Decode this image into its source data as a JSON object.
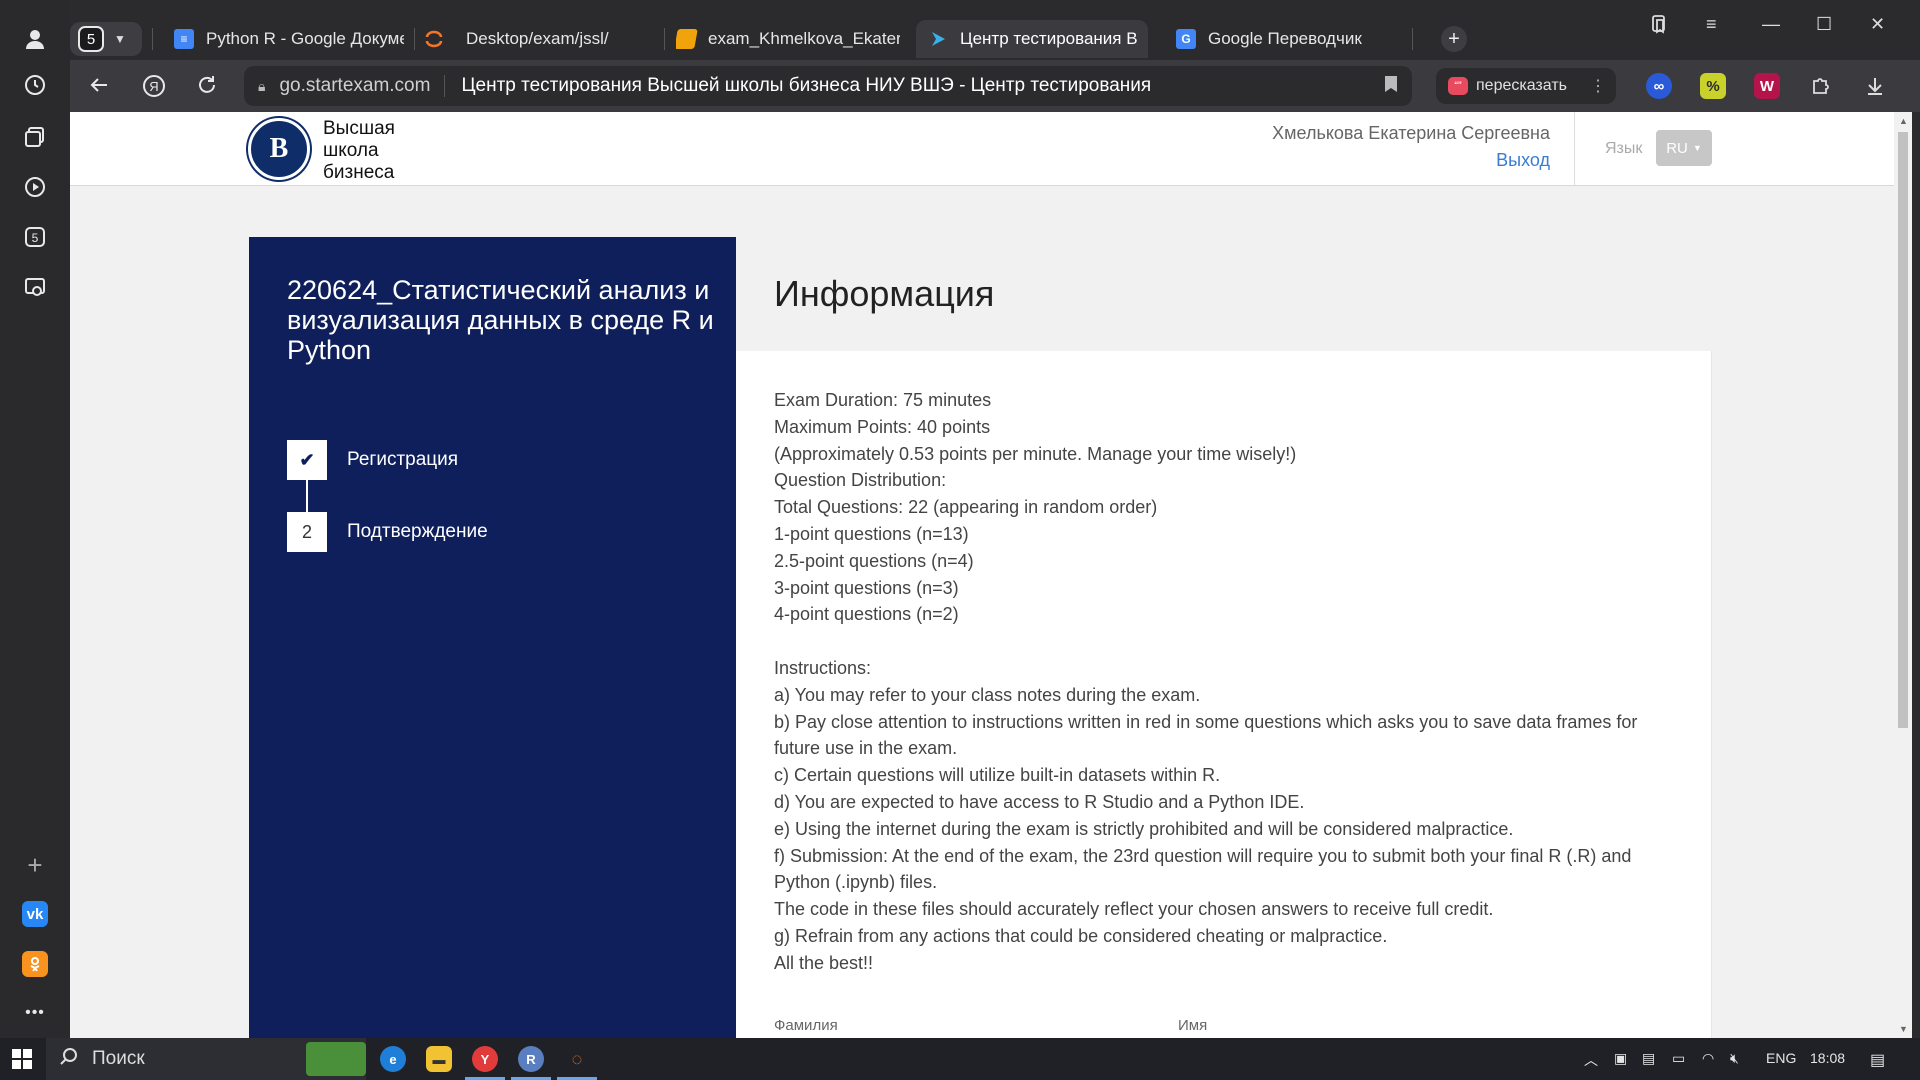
{
  "browser": {
    "tab_count": "5",
    "tabs": [
      {
        "label": "Python R - Google Докуме",
        "icon": "google-docs-icon",
        "color": "#4285f4"
      },
      {
        "label": "Desktop/exam/jssl/",
        "icon": "jupyter-icon",
        "color": "#f37626"
      },
      {
        "label": "exam_Khmelkova_Ekaterin",
        "icon": "notebook-icon",
        "color": "#f0a30a"
      },
      {
        "label": "Центр тестирования В",
        "icon": "startexam-icon",
        "color": "#3ab0e8",
        "active": true
      },
      {
        "label": "Google Переводчик",
        "icon": "google-translate-icon",
        "color": "#4285f4"
      }
    ],
    "address": {
      "domain": "go.startexam.com",
      "title": "Центр тестирования Высшей школы бизнеса НИУ ВШЭ - Центр тестирования"
    },
    "retell_label": "пересказать"
  },
  "header": {
    "logo_letter": "В",
    "logo_line1": "Высшая",
    "logo_line2": "школа",
    "logo_line3": "бизнеса",
    "user_name": "Хмелькова Екатерина Сергеевна",
    "logout": "Выход",
    "lang_label": "Язык",
    "lang_value": "RU"
  },
  "sidebar": {
    "course_title": "220624_Статистический анализ и визуализация данных в среде R и Python",
    "steps": [
      {
        "marker": "✔",
        "label": "Регистрация"
      },
      {
        "marker": "2",
        "label": "Подтверждение"
      }
    ]
  },
  "main": {
    "heading": "Информация",
    "lines": [
      "Exam Duration: 75 minutes",
      "Maximum Points: 40 points",
      "(Approximately 0.53 points per minute. Manage your time wisely!)",
      "Question Distribution:",
      "Total Questions: 22 (appearing in random order)",
      "1-point questions (n=13)",
      "2.5-point questions (n=4)",
      "3-point questions (n=3)",
      "4-point questions (n=2)",
      "",
      "Instructions:",
      "a) You may refer to your class notes during the exam.",
      "b) Pay close attention to instructions written in red in some questions which asks you to save data frames for future use in the exam.",
      "c) Certain questions will utilize built-in datasets within R.",
      "d) You are expected to have access to R Studio and a Python IDE.",
      "e) Using the internet during the exam is strictly prohibited and will be considered malpractice.",
      "f) Submission: At the end of the exam, the 23rd question will require you to submit both your final R (.R) and Python (.ipynb) files.",
      "The code in these files should accurately reflect your chosen answers to receive full credit.",
      "g) Refrain from any actions that could be considered cheating or malpractice.",
      "All the best!!"
    ],
    "form_label_1": "Фамилия",
    "form_label_2": "Имя"
  },
  "taskbar": {
    "search": "Поиск",
    "lang": "ENG",
    "time": "18:08"
  },
  "colors": {
    "sidebar_panel": "#0f1f5c",
    "link": "#3a7bd5",
    "browser_dark": "#2b2b2e"
  }
}
